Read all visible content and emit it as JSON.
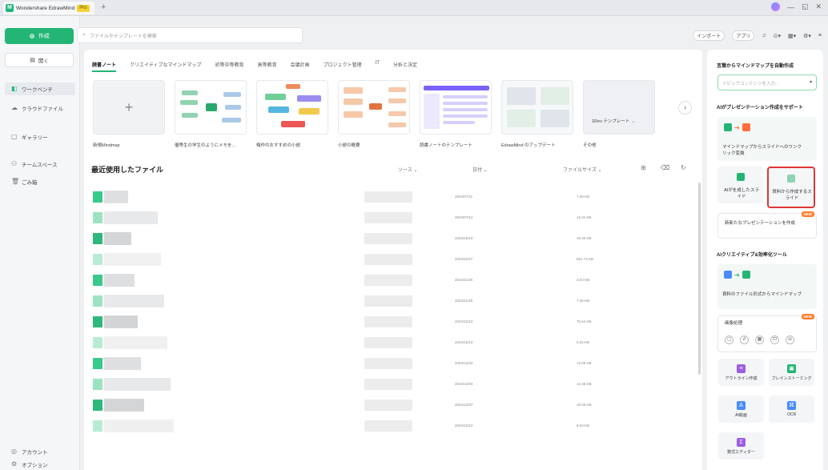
{
  "titlebar": {
    "app_title": "Wondershare EdrawMind",
    "pro": "Pro",
    "new_tab": "+",
    "controls": [
      "—",
      "◱",
      "✕"
    ]
  },
  "sidebar": {
    "new_label": "作成",
    "open_label": "開く",
    "items": [
      {
        "label": "ワークベンチ",
        "icon": "workbench-icon",
        "active": true
      },
      {
        "label": "クラウドファイル",
        "icon": "cloud-icon"
      },
      {
        "label": "ギャラリー",
        "icon": "gallery-icon"
      },
      {
        "label": "チームスペース",
        "icon": "team-icon"
      },
      {
        "label": "ごみ箱",
        "icon": "trash-icon"
      }
    ],
    "bottom": [
      "アカウント",
      "オプション"
    ]
  },
  "search": {
    "placeholder": "ファイルやテンプレートを検索"
  },
  "toolbar": {
    "import": "インポート",
    "app": "アプリ"
  },
  "categories": [
    "読書ノート",
    "クリエイティブなマインドマップ",
    "初等中等教育",
    "高等教育",
    "会議計画",
    "プロジェクト管理",
    "IT",
    "分析と決定"
  ],
  "templates": [
    {
      "label": "新規Mindmap",
      "kind": "new"
    },
    {
      "label": "優等生の学生のようにメモを...",
      "kind": "mm"
    },
    {
      "label": "梅作のおすすめの小説",
      "kind": "mm"
    },
    {
      "label": "小説の概要",
      "kind": "mm"
    },
    {
      "label": "読書ノートのテンプレート",
      "kind": "doc"
    },
    {
      "label": "EdrawMind のアップデート",
      "kind": "shot"
    },
    {
      "label": "その他",
      "kind": "more",
      "more_text": "1Rev テンプレート →"
    }
  ],
  "scroll_next": "›",
  "recent": {
    "title": "最近使用したファイル",
    "col_source": "ソース",
    "col_date": "日付",
    "col_size": "ファイルサイズ",
    "rows": [
      {
        "date": "2024/07/11",
        "size": "7.09 KB"
      },
      {
        "date": "2024/07/14",
        "size": "12.01 KB"
      },
      {
        "date": "2024/10/18",
        "size": "16.40 KB"
      },
      {
        "date": "2024/11/27",
        "size": "661.74 KB"
      },
      {
        "date": "2024/11/28",
        "size": "3.03 KB"
      },
      {
        "date": "2024/11/28",
        "size": "7.36 KB"
      },
      {
        "date": "2024/12/10",
        "size": "75.54 KB"
      },
      {
        "date": "2024/12/10",
        "size": "6.51 KB"
      },
      {
        "date": "2024/12/04",
        "size": "12.09 KB"
      },
      {
        "date": "2024/12/04",
        "size": "13.35 KB"
      },
      {
        "date": "2024/12/07",
        "size": "10.09 KB"
      },
      {
        "date": "2024/12/10",
        "size": "8.54 KB"
      }
    ]
  },
  "rpanel": {
    "head1": "言葉からマインドマップを自動作成",
    "input_placeholder": "トピックコンテンツを入力...",
    "head2": "AIがプレゼンテーション作成をサポート",
    "card_mm_slide": "マインドマップからスライドへのワンクリック変換",
    "card_ai_slide": "AIがを成したスライド",
    "card_doc_slide": "資料から作成するスライド",
    "card_new_pres": "新新たなプレゼンテーションを作成",
    "new": "NEW",
    "head3": "AIクリエイティブ&効率化ツール",
    "card_file_mm": "資料のファイル形式からマインドマップ",
    "card_ocr_head": "画像処理",
    "tools": [
      {
        "label": "アウトライン作成",
        "color": "#9b5de5"
      },
      {
        "label": "ブレインストーミング",
        "color": "#22b573"
      },
      {
        "label": "AI絵画",
        "color": "#4a8cff"
      },
      {
        "label": "OCR",
        "color": "#4a8cff"
      },
      {
        "label": "数式エディター",
        "color": "#9b5de5"
      }
    ]
  }
}
